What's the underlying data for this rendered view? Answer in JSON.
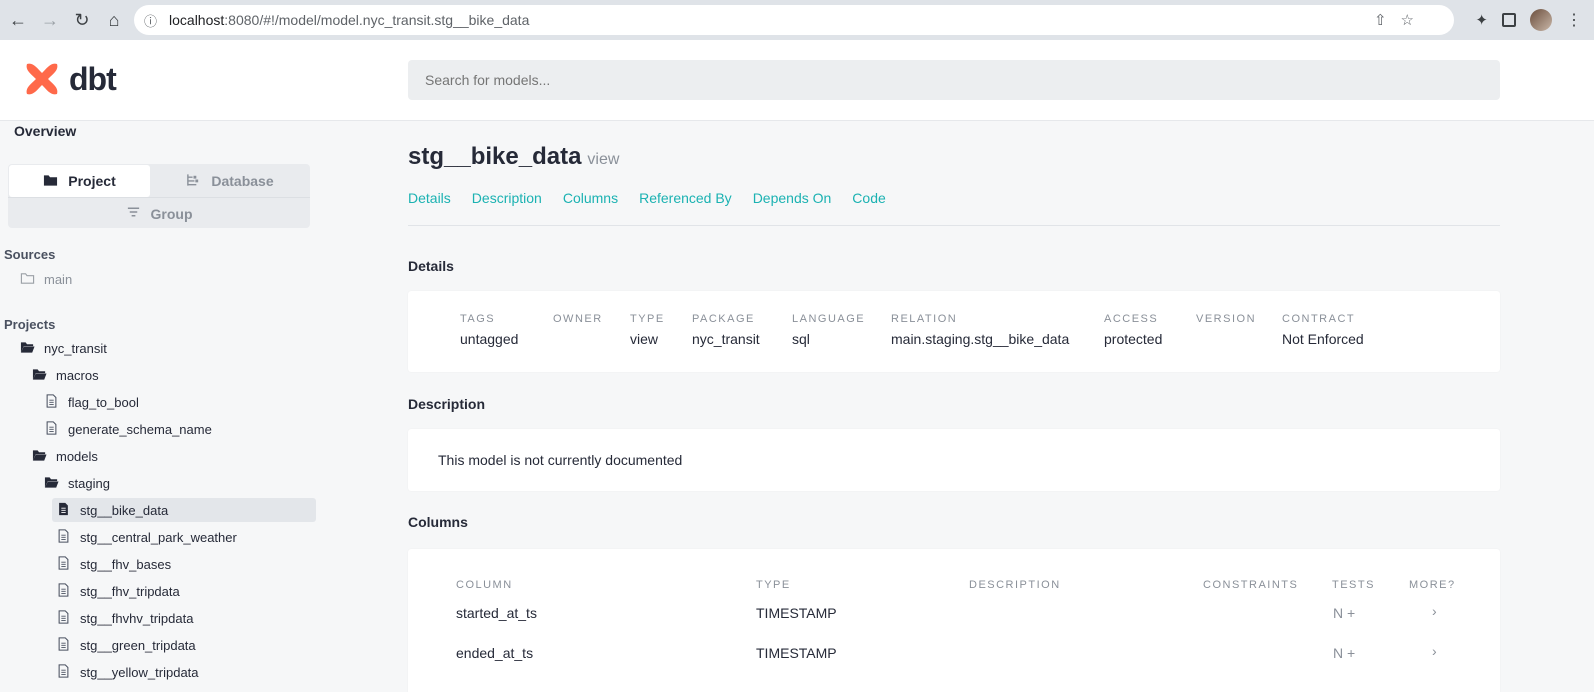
{
  "browser": {
    "url_host": "localhost",
    "url_path": ":8080/#!/model/model.nyc_transit.stg__bike_data"
  },
  "app": {
    "logo_text": "dbt",
    "search_placeholder": "Search for models..."
  },
  "sidebar": {
    "overview_label": "Overview",
    "toggle": {
      "project": "Project",
      "database": "Database",
      "group": "Group"
    },
    "sources_title": "Sources",
    "sources": [
      {
        "label": "main"
      }
    ],
    "projects_title": "Projects",
    "tree": [
      {
        "label": "nyc_transit",
        "kind": "folder-open"
      },
      {
        "label": "macros",
        "kind": "folder-open"
      },
      {
        "label": "flag_to_bool",
        "kind": "file"
      },
      {
        "label": "generate_schema_name",
        "kind": "file"
      },
      {
        "label": "models",
        "kind": "folder-open"
      },
      {
        "label": "staging",
        "kind": "folder-open"
      },
      {
        "label": "stg__bike_data",
        "kind": "file-filled",
        "active": true
      },
      {
        "label": "stg__central_park_weather",
        "kind": "file"
      },
      {
        "label": "stg__fhv_bases",
        "kind": "file"
      },
      {
        "label": "stg__fhv_tripdata",
        "kind": "file"
      },
      {
        "label": "stg__fhvhv_tripdata",
        "kind": "file"
      },
      {
        "label": "stg__green_tripdata",
        "kind": "file"
      },
      {
        "label": "stg__yellow_tripdata",
        "kind": "file"
      }
    ]
  },
  "model": {
    "name": "stg__bike_data",
    "materialization": "view",
    "tabs": [
      "Details",
      "Description",
      "Columns",
      "Referenced By",
      "Depends On",
      "Code"
    ]
  },
  "details": {
    "title": "Details",
    "fields": [
      {
        "label": "TAGS",
        "value": "untagged"
      },
      {
        "label": "OWNER",
        "value": ""
      },
      {
        "label": "TYPE",
        "value": "view"
      },
      {
        "label": "PACKAGE",
        "value": "nyc_transit"
      },
      {
        "label": "LANGUAGE",
        "value": "sql"
      },
      {
        "label": "RELATION",
        "value": "main.staging.stg__bike_data"
      },
      {
        "label": "ACCESS",
        "value": "protected"
      },
      {
        "label": "VERSION",
        "value": ""
      },
      {
        "label": "CONTRACT",
        "value": "Not Enforced"
      }
    ]
  },
  "description": {
    "title": "Description",
    "text": "This model is not currently documented"
  },
  "columns": {
    "title": "Columns",
    "headers": [
      "COLUMN",
      "TYPE",
      "DESCRIPTION",
      "CONSTRAINTS",
      "TESTS",
      "MORE?"
    ],
    "rows": [
      {
        "column": "started_at_ts",
        "type": "TIMESTAMP",
        "description": "",
        "constraints": "",
        "tests": "N +",
        "more": "›"
      },
      {
        "column": "ended_at_ts",
        "type": "TIMESTAMP",
        "description": "",
        "constraints": "",
        "tests": "N +",
        "more": "›"
      }
    ]
  }
}
